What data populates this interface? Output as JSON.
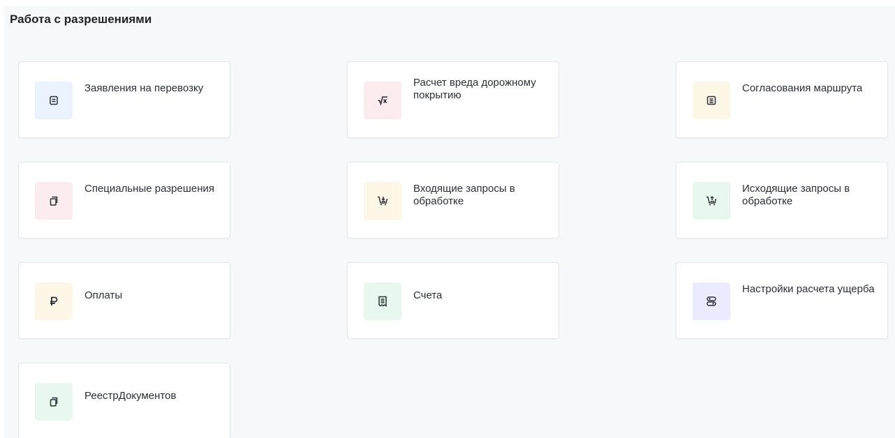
{
  "page": {
    "title": "Работа с разрешениями"
  },
  "colors": {
    "tile_blue": "#eaf3fe",
    "tile_red": "#fdecef",
    "tile_yellow": "#fdf7e8",
    "tile_green": "#e8f8ee",
    "tile_purple": "#ecebfd",
    "icon_stroke": "#2b2f36"
  },
  "cards": [
    {
      "label": "Заявления на перевозку",
      "icon": "document-icon",
      "tile": "blue"
    },
    {
      "label": "Расчет вреда дорожному покрытию",
      "icon": "square-root-icon",
      "tile": "red"
    },
    {
      "label": "Согласования маршрута",
      "icon": "document-list-icon",
      "tile": "yellow"
    },
    {
      "label": "Специальные разрешения",
      "icon": "copy-icon",
      "tile": "red"
    },
    {
      "label": "Входящие запросы в обработке",
      "icon": "cart-in-icon",
      "tile": "yellow"
    },
    {
      "label": "Исходящие запросы в обработке",
      "icon": "cart-out-icon",
      "tile": "green"
    },
    {
      "label": "Оплаты",
      "icon": "ruble-icon",
      "tile": "yellow"
    },
    {
      "label": "Счета",
      "icon": "receipt-icon",
      "tile": "green"
    },
    {
      "label": "Настройки расчета ущерба",
      "icon": "settings-toggle-icon",
      "tile": "purple"
    },
    {
      "label": "РеестрДокументов",
      "icon": "copy-icon",
      "tile": "green"
    }
  ]
}
